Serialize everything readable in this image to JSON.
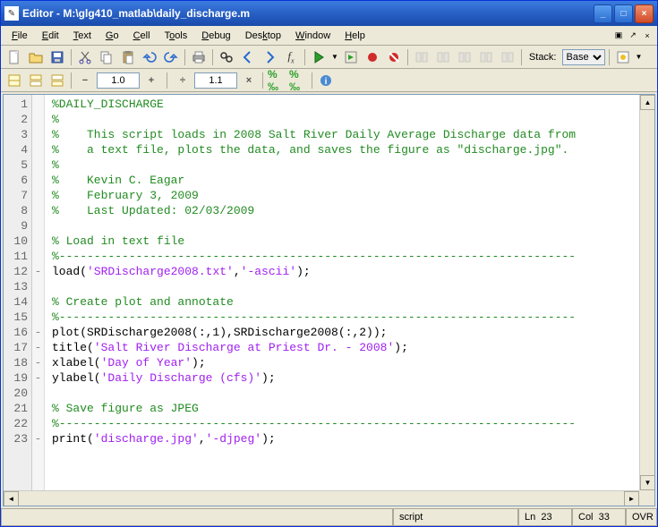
{
  "title": "Editor - M:\\glg410_matlab\\daily_discharge.m",
  "menu": {
    "file": "File",
    "edit": "Edit",
    "text": "Text",
    "go": "Go",
    "cell": "Cell",
    "tools": "Tools",
    "debug": "Debug",
    "desktop": "Desktop",
    "window": "Window",
    "help": "Help"
  },
  "toolbar2": {
    "zoom1": "1.0",
    "zoom2": "1.1",
    "stack_label": "Stack:",
    "stack_value": "Base"
  },
  "status": {
    "type": "script",
    "ln_label": "Ln",
    "ln": "23",
    "col_label": "Col",
    "col": "33",
    "ovr": "OVR"
  },
  "code": {
    "lines": [
      {
        "n": "1",
        "m": "",
        "tokens": [
          {
            "t": "%DAILY_DISCHARGE",
            "c": "c-comment"
          }
        ]
      },
      {
        "n": "2",
        "m": "",
        "tokens": [
          {
            "t": "%",
            "c": "c-comment"
          }
        ]
      },
      {
        "n": "3",
        "m": "",
        "tokens": [
          {
            "t": "%    This script loads in 2008 Salt River Daily Average Discharge data from",
            "c": "c-comment"
          }
        ]
      },
      {
        "n": "4",
        "m": "",
        "tokens": [
          {
            "t": "%    a text file, plots the data, and saves the figure as \"discharge.jpg\".",
            "c": "c-comment"
          }
        ]
      },
      {
        "n": "5",
        "m": "",
        "tokens": [
          {
            "t": "%",
            "c": "c-comment"
          }
        ]
      },
      {
        "n": "6",
        "m": "",
        "tokens": [
          {
            "t": "%    Kevin C. Eagar",
            "c": "c-comment"
          }
        ]
      },
      {
        "n": "7",
        "m": "",
        "tokens": [
          {
            "t": "%    February 3, 2009",
            "c": "c-comment"
          }
        ]
      },
      {
        "n": "8",
        "m": "",
        "tokens": [
          {
            "t": "%    Last Updated: 02/03/2009",
            "c": "c-comment"
          }
        ]
      },
      {
        "n": "9",
        "m": "",
        "tokens": []
      },
      {
        "n": "10",
        "m": "",
        "tokens": [
          {
            "t": "% Load in text file",
            "c": "c-comment"
          }
        ]
      },
      {
        "n": "11",
        "m": "",
        "tokens": [
          {
            "t": "%--------------------------------------------------------------------------",
            "c": "c-comment"
          }
        ]
      },
      {
        "n": "12",
        "m": "-",
        "tokens": [
          {
            "t": "load(",
            "c": "c-func"
          },
          {
            "t": "'SRDischarge2008.txt'",
            "c": "c-string"
          },
          {
            "t": ",",
            "c": "c-func"
          },
          {
            "t": "'-ascii'",
            "c": "c-string"
          },
          {
            "t": ");",
            "c": "c-func"
          }
        ]
      },
      {
        "n": "13",
        "m": "",
        "tokens": []
      },
      {
        "n": "14",
        "m": "",
        "tokens": [
          {
            "t": "% Create plot and annotate",
            "c": "c-comment"
          }
        ]
      },
      {
        "n": "15",
        "m": "",
        "tokens": [
          {
            "t": "%--------------------------------------------------------------------------",
            "c": "c-comment"
          }
        ]
      },
      {
        "n": "16",
        "m": "-",
        "tokens": [
          {
            "t": "plot(SRDischarge2008(:,1),SRDischarge2008(:,2));",
            "c": "c-func"
          }
        ]
      },
      {
        "n": "17",
        "m": "-",
        "tokens": [
          {
            "t": "title(",
            "c": "c-func"
          },
          {
            "t": "'Salt River Discharge at Priest Dr. - 2008'",
            "c": "c-string"
          },
          {
            "t": ");",
            "c": "c-func"
          }
        ]
      },
      {
        "n": "18",
        "m": "-",
        "tokens": [
          {
            "t": "xlabel(",
            "c": "c-func"
          },
          {
            "t": "'Day of Year'",
            "c": "c-string"
          },
          {
            "t": ");",
            "c": "c-func"
          }
        ]
      },
      {
        "n": "19",
        "m": "-",
        "tokens": [
          {
            "t": "ylabel(",
            "c": "c-func"
          },
          {
            "t": "'Daily Discharge (cfs)'",
            "c": "c-string"
          },
          {
            "t": ");",
            "c": "c-func"
          }
        ]
      },
      {
        "n": "20",
        "m": "",
        "tokens": []
      },
      {
        "n": "21",
        "m": "",
        "tokens": [
          {
            "t": "% Save figure as JPEG",
            "c": "c-comment"
          }
        ]
      },
      {
        "n": "22",
        "m": "",
        "tokens": [
          {
            "t": "%--------------------------------------------------------------------------",
            "c": "c-comment"
          }
        ]
      },
      {
        "n": "23",
        "m": "-",
        "tokens": [
          {
            "t": "print(",
            "c": "c-func"
          },
          {
            "t": "'discharge.jpg'",
            "c": "c-string"
          },
          {
            "t": ",",
            "c": "c-func"
          },
          {
            "t": "'-djpeg'",
            "c": "c-string"
          },
          {
            "t": ");",
            "c": "c-func"
          }
        ]
      }
    ]
  }
}
